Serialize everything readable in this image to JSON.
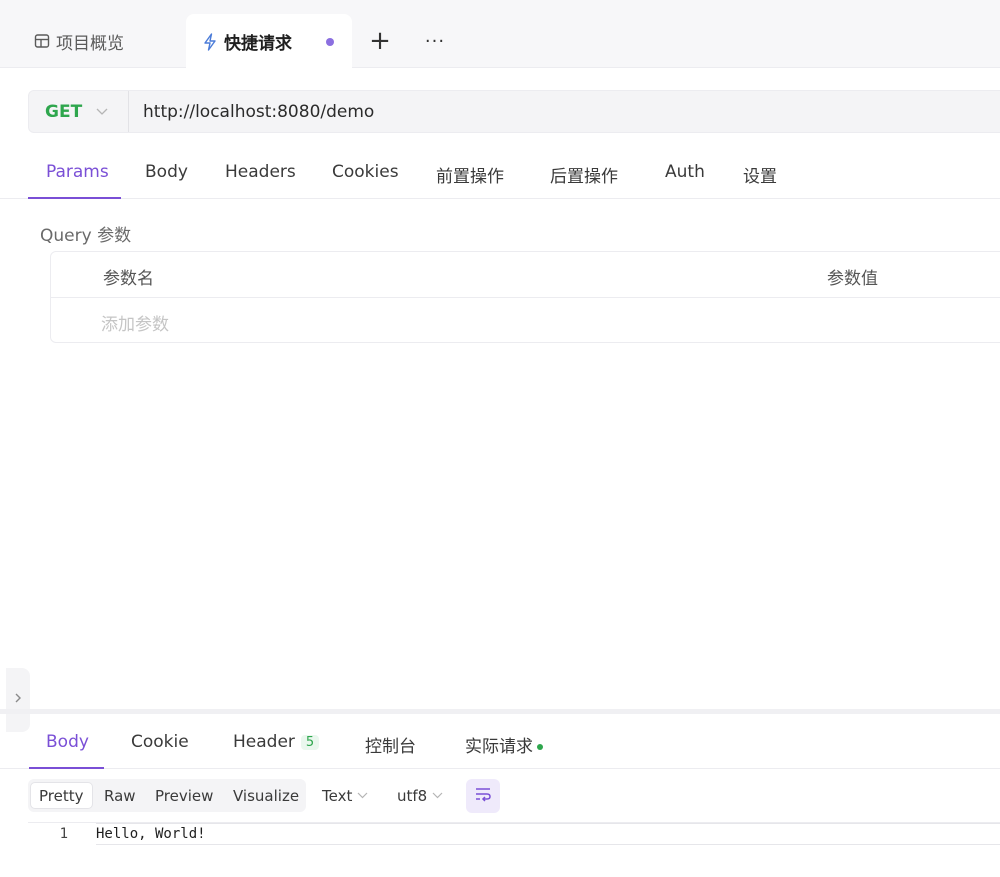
{
  "tabs": {
    "overview_label": "项目概览",
    "quick_label": "快捷请求",
    "add_label": "+",
    "more_label": "···"
  },
  "request": {
    "method": "GET",
    "url": "http://localhost:8080/demo"
  },
  "request_tabs": [
    "Params",
    "Body",
    "Headers",
    "Cookies",
    "前置操作",
    "后置操作",
    "Auth",
    "设置"
  ],
  "query": {
    "section_label": "Query 参数",
    "col_name": "参数名",
    "col_value": "参数值",
    "add_placeholder": "添加参数"
  },
  "response": {
    "tabs": {
      "body": "Body",
      "cookie": "Cookie",
      "header": "Header",
      "header_count": "5",
      "console": "控制台",
      "actual_request": "实际请求"
    },
    "format_buttons": [
      "Pretty",
      "Raw",
      "Preview",
      "Visualize"
    ],
    "content_type": "Text",
    "encoding": "utf8",
    "line_number": "1",
    "body_text": "Hello, World!"
  },
  "colors": {
    "accent": "#7a4fd6",
    "method_get": "#2ea64d",
    "unsaved_dot": "#8b6fe0"
  },
  "icons": [
    "layout-icon",
    "lightning-icon",
    "plus-icon",
    "more-icon",
    "chevron-down-icon",
    "chevron-right-icon",
    "wrap-lines-icon"
  ]
}
